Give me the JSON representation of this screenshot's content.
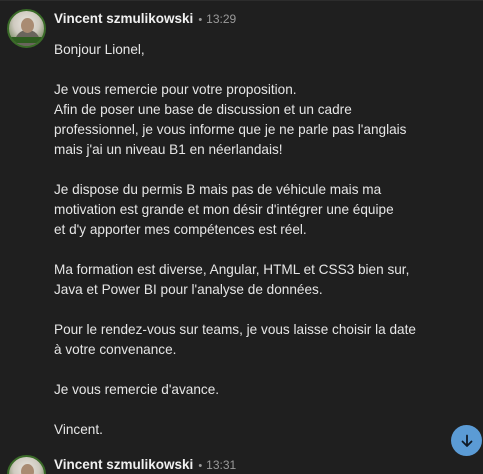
{
  "messages": [
    {
      "author": "Vincent szmulikowski",
      "separator": "•",
      "time": "13:29",
      "avatar_icon": "user-avatar-icon",
      "paragraphs": [
        [
          "Bonjour Lionel,"
        ],
        [
          "Je vous remercie pour votre proposition.",
          "Afin de poser une base de discussion et un cadre",
          "professionnel, je vous informe que je ne parle pas l'anglais",
          "mais j'ai un niveau B1 en néerlandais!"
        ],
        [
          "Je dispose du permis B mais pas de véhicule mais ma",
          "motivation est grande et mon désir d'intégrer une équipe",
          "et d'y apporter mes compétences est réel."
        ],
        [
          "Ma formation est diverse, Angular, HTML et CSS3 bien sur,",
          "Java et Power BI pour l'analyse de données."
        ],
        [
          "Pour le rendez-vous sur teams, je vous laisse choisir la date",
          "à votre convenance."
        ],
        [
          "Je vous remercie d'avance."
        ],
        [
          "Vincent."
        ]
      ]
    },
    {
      "author": "Vincent szmulikowski",
      "separator": "•",
      "time": "13:31",
      "avatar_icon": "user-avatar-icon"
    }
  ],
  "scroll_button": {
    "icon": "arrow-down-icon",
    "color": "#5b9bd5"
  },
  "colors": {
    "background": "#1f1f1f",
    "text": "#e6e6e6",
    "muted": "#9a9a9a",
    "accent": "#5b9bd5"
  }
}
